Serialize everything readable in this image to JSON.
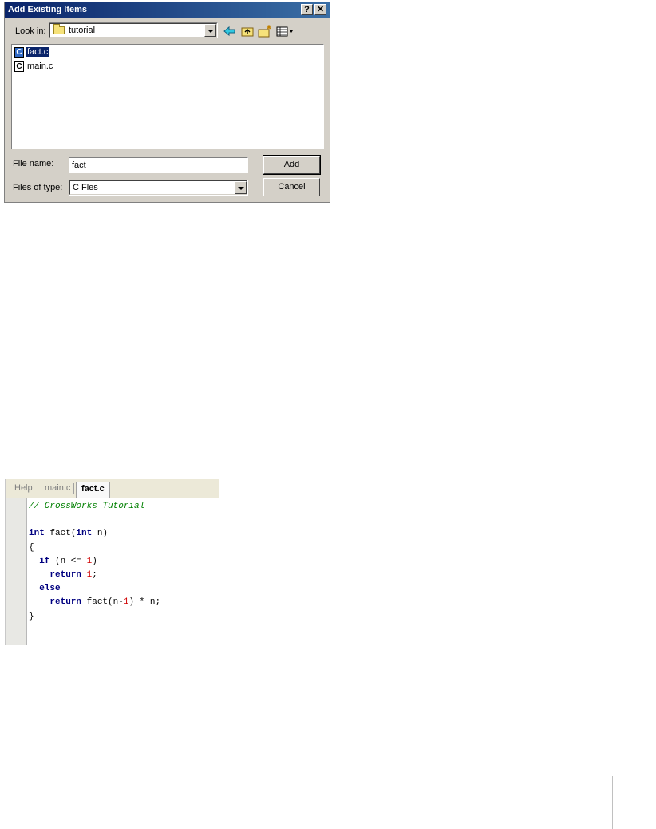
{
  "dialog": {
    "title": "Add Existing Items",
    "help_glyph": "?",
    "close_glyph": "✕",
    "look_in_label": "Look in:",
    "look_in_value": "tutorial",
    "files": [
      {
        "name": "fact.c",
        "selected": true
      },
      {
        "name": "main.c",
        "selected": false
      }
    ],
    "file_name_label": "File name:",
    "file_name_value": "fact",
    "files_of_type_label": "Files of type:",
    "files_of_type_value": "C Fles",
    "add_label": "Add",
    "cancel_label": "Cancel"
  },
  "editor": {
    "tabs": [
      "Help",
      "main.c",
      "fact.c"
    ],
    "active_tab": "fact.c",
    "code": {
      "l1": "// CrossWorks Tutorial",
      "l3_kw1": "int",
      "l3_a": " fact(",
      "l3_kw2": "int",
      "l3_b": " n)",
      "l4": "{",
      "l5_indent": "  ",
      "l5_kw": "if",
      "l5_a": " (n <= ",
      "l5_num": "1",
      "l5_b": ")",
      "l6_indent": "    ",
      "l6_kw": "return",
      "l6_sp": " ",
      "l6_num": "1",
      "l6_b": ";",
      "l7_indent": "  ",
      "l7_kw": "else",
      "l8_indent": "    ",
      "l8_kw": "return",
      "l8_a": " fact(n-",
      "l8_num": "1",
      "l8_b": ") * n;",
      "l9": "}"
    }
  }
}
